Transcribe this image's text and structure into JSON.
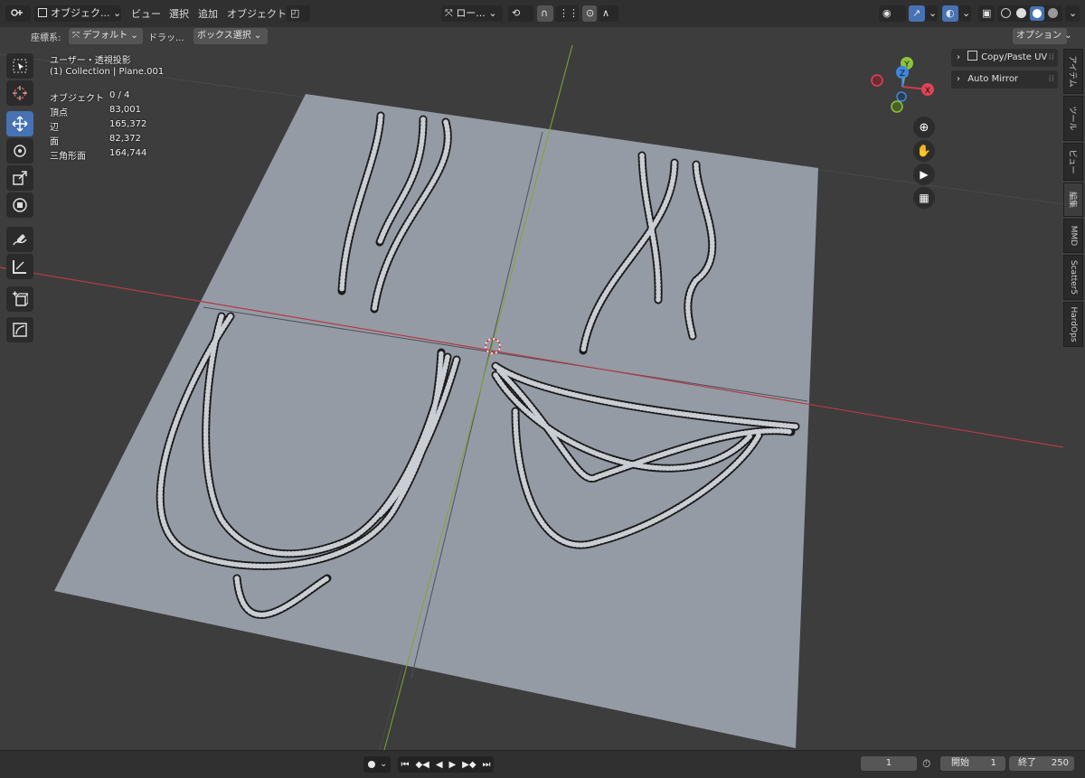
{
  "header": {
    "mode_label": "オブジェク...",
    "menus": [
      "ビュー",
      "選択",
      "追加",
      "オブジェクト"
    ],
    "transform_label": "ロー...",
    "options_label": "オプション"
  },
  "toolheader": {
    "coord_label": "座標系:",
    "coord_value": "デフォルト",
    "drag_label": "ドラッ...",
    "select_mode": "ボックス選択"
  },
  "overlay": {
    "view_name": "ユーザー・透視投影",
    "collection": "(1) Collection | Plane.001",
    "stats": [
      {
        "label": "オブジェクト",
        "value": "0 / 4"
      },
      {
        "label": "頂点",
        "value": "83,001"
      },
      {
        "label": "辺",
        "value": "165,372"
      },
      {
        "label": "面",
        "value": "82,372"
      },
      {
        "label": "三角形面",
        "value": "164,744"
      }
    ]
  },
  "gizmo": {
    "x": "X",
    "y": "Y",
    "z": "Z"
  },
  "npanel": {
    "items": [
      "Copy/Paste UV",
      "Auto Mirror"
    ],
    "tabs": [
      "アイテム",
      "ツール",
      "ビュー",
      "編集",
      "MMD",
      "Scatter5",
      "HardOps"
    ]
  },
  "timeline": {
    "current_frame": "1",
    "start_label": "開始",
    "start_value": "1",
    "end_label": "終了",
    "end_value": "250"
  },
  "colors": {
    "accent": "#4772b3",
    "x_axis": "#c03040",
    "y_axis": "#80a830",
    "plane": "#959ba5"
  }
}
